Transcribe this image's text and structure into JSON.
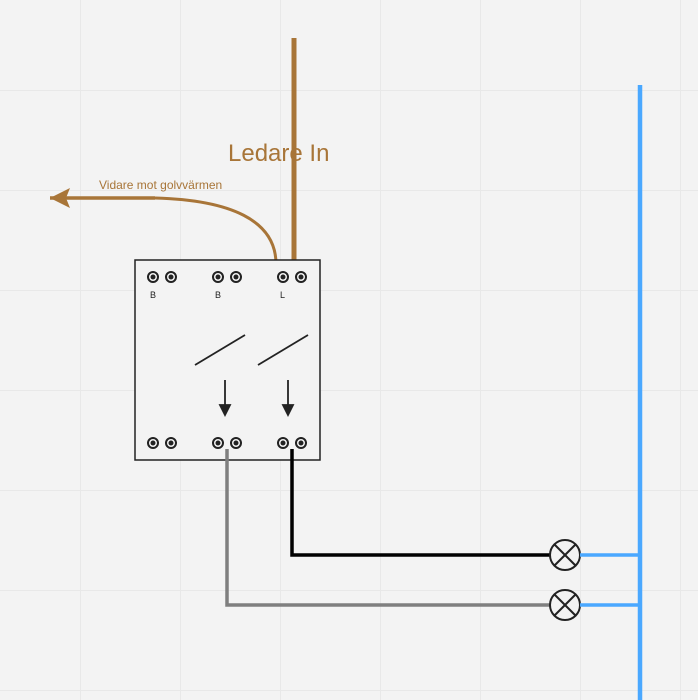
{
  "labels": {
    "main": "Ledare In",
    "arrow": "Vidare mot golvvärmen",
    "pin_b1": "B",
    "pin_b2": "B",
    "pin_l": "L"
  },
  "colors": {
    "brown": "#a87538",
    "black": "#000000",
    "grey": "#7f7f7f",
    "blue": "#4aa8ff",
    "box": "#222222",
    "bg": "#f3f3f3"
  },
  "diagram": {
    "type": "electrical-wiring",
    "description": "Double switch module with incoming conductor (Ledare In), branch going to floor heating (Vidare mot golvvärmen), two outgoing switched wires (black, grey) each going to a lamp symbol, lamps connected to a blue neutral bus.",
    "components": [
      {
        "id": "switch-module",
        "type": "2-gang switch",
        "terminals_top": [
          "B",
          "B",
          "B",
          "B",
          "L",
          "L"
        ],
        "terminals_bottom": 6
      },
      {
        "id": "lamp1",
        "type": "lamp",
        "connected": [
          "switch-out-1",
          "neutral-bus"
        ]
      },
      {
        "id": "lamp2",
        "type": "lamp",
        "connected": [
          "switch-out-2",
          "neutral-bus"
        ]
      }
    ],
    "wires": [
      {
        "color": "brown",
        "from": "supply",
        "to": "switch-L-top",
        "label": "Ledare In"
      },
      {
        "color": "brown",
        "from": "switch-L-top-left",
        "to": "floor-heating",
        "label": "Vidare mot golvvärmen"
      },
      {
        "color": "black",
        "from": "switch-bottom-right",
        "to": "lamp1"
      },
      {
        "color": "grey",
        "from": "switch-bottom-mid",
        "to": "lamp2"
      },
      {
        "color": "blue",
        "from": "lamp1",
        "to": "neutral-bus"
      },
      {
        "color": "blue",
        "from": "lamp2",
        "to": "neutral-bus"
      },
      {
        "color": "blue",
        "from": "neutral-bus-top",
        "to": "neutral-bus-bottom"
      }
    ]
  }
}
